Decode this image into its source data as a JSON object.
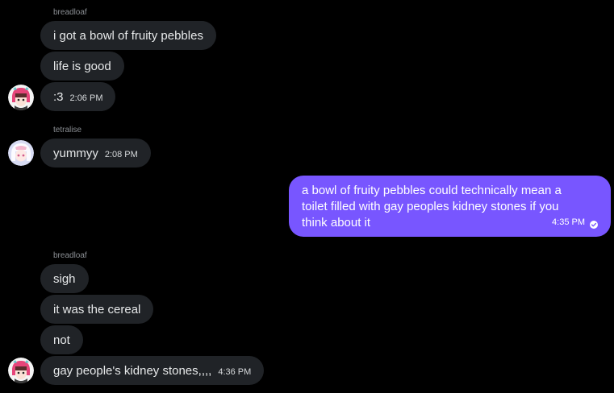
{
  "conversation": {
    "groups": [
      {
        "sender": "breadloaf",
        "messages": [
          {
            "text": "i got a bowl of fruity pebbles"
          },
          {
            "text": "life is good"
          },
          {
            "text": ":3",
            "time": "2:06 PM"
          }
        ]
      },
      {
        "sender": "tetralise",
        "messages": [
          {
            "text": "yummyy",
            "time": "2:08 PM"
          }
        ]
      },
      {
        "sender": "breadloaf",
        "messages": [
          {
            "text": "sigh"
          },
          {
            "text": "it was the cereal"
          },
          {
            "text": "not"
          },
          {
            "text": "gay people's kidney stones,,,,",
            "time": "4:36 PM"
          }
        ]
      }
    ],
    "outgoing": {
      "lines": [
        "a bowl of fruity pebbles could technically mean a",
        "toilet filled with gay peoples kidney stones if you",
        "think about it"
      ],
      "time": "4:35 PM",
      "status_icon": "read-check-icon"
    }
  },
  "colors": {
    "background": "#000000",
    "incoming_bubble": "#202327",
    "outgoing_bubble": "#7856ff",
    "sender_name": "#8b8f94"
  },
  "avatars": {
    "breadloaf": "pink-hair-character-avatar",
    "tetralise": "white-pink-character-avatar"
  }
}
